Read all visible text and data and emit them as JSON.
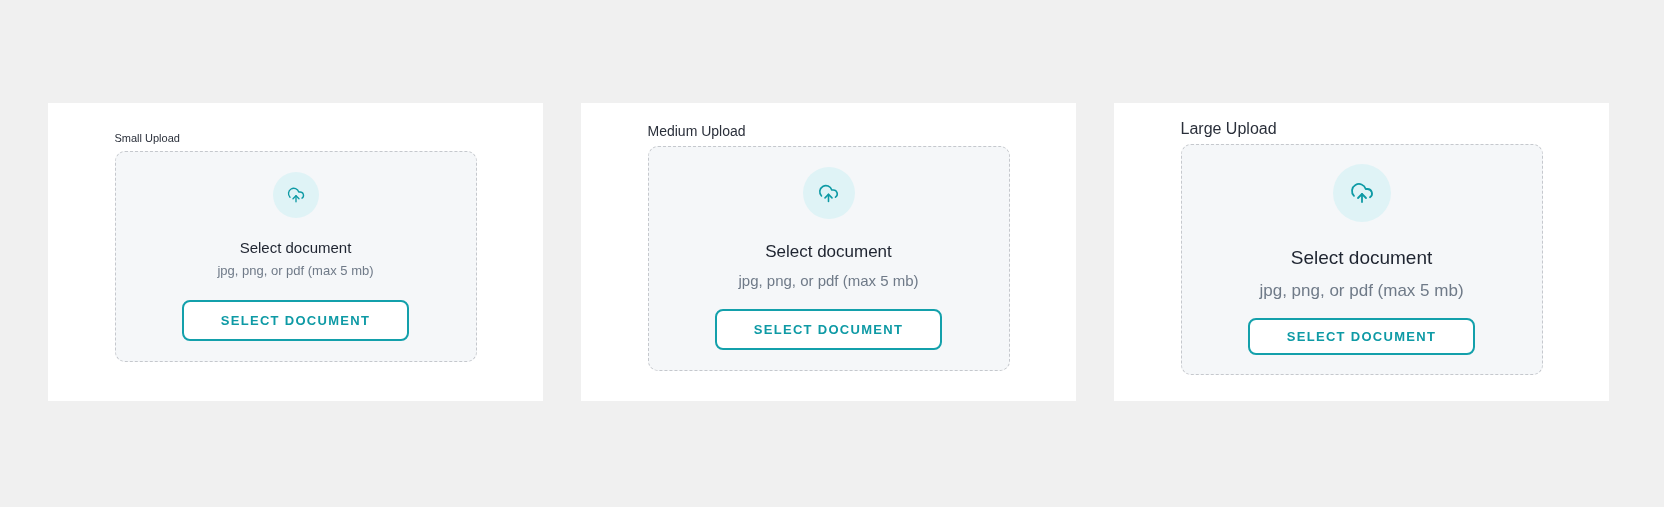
{
  "uploads": [
    {
      "kind": "small",
      "label": "Small Upload",
      "title": "Select document",
      "hint": "jpg, png, or pdf (max 5 mb)",
      "button": "SELECT DOCUMENT"
    },
    {
      "kind": "medium",
      "label": "Medium Upload",
      "title": "Select document",
      "hint": "jpg, png, or pdf (max 5 mb)",
      "button": "SELECT DOCUMENT"
    },
    {
      "kind": "large",
      "label": "Large Upload",
      "title": "Select document",
      "hint": "jpg, png, or pdf (max 5 mb)",
      "button": "SELECT DOCUMENT"
    }
  ]
}
